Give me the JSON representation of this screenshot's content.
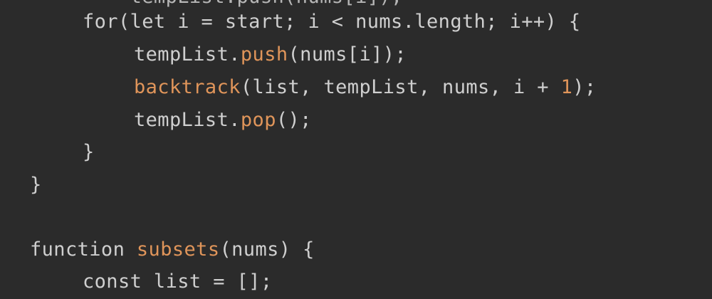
{
  "colors": {
    "background": "#2b2b2b",
    "text": "#cfcfcf",
    "function_call": "#e0955a",
    "number_literal": "#e0955a"
  },
  "lines": [
    {
      "id": "partial-top",
      "tokens": [
        {
          "t": "    tempList.push(nums[i]);",
          "k": "partial"
        }
      ]
    },
    {
      "id": "for-loop",
      "tokens": [
        {
          "t": "for(let i = start; i < nums.length; i++) {",
          "k": "plain"
        }
      ]
    },
    {
      "id": "push-call",
      "tokens": [
        {
          "t": "tempList.",
          "k": "plain"
        },
        {
          "t": "push",
          "k": "fn"
        },
        {
          "t": "(nums[i]);",
          "k": "plain"
        }
      ]
    },
    {
      "id": "backtrack-call",
      "tokens": [
        {
          "t": "backtrack",
          "k": "fn"
        },
        {
          "t": "(list, tempList, nums, i + ",
          "k": "plain"
        },
        {
          "t": "1",
          "k": "num"
        },
        {
          "t": ");",
          "k": "plain"
        }
      ]
    },
    {
      "id": "pop-call",
      "tokens": [
        {
          "t": "tempList.",
          "k": "plain"
        },
        {
          "t": "pop",
          "k": "fn"
        },
        {
          "t": "();",
          "k": "plain"
        }
      ]
    },
    {
      "id": "close-for",
      "tokens": [
        {
          "t": "}",
          "k": "plain"
        }
      ]
    },
    {
      "id": "close-fn",
      "tokens": [
        {
          "t": "}",
          "k": "plain"
        }
      ]
    },
    {
      "id": "blank",
      "tokens": [
        {
          "t": "",
          "k": "plain"
        }
      ]
    },
    {
      "id": "subsets-decl",
      "tokens": [
        {
          "t": "function ",
          "k": "plain"
        },
        {
          "t": "subsets",
          "k": "fn"
        },
        {
          "t": "(nums) {",
          "k": "plain"
        }
      ]
    },
    {
      "id": "const-list",
      "tokens": [
        {
          "t": "const list = [];",
          "k": "plain"
        }
      ]
    }
  ]
}
